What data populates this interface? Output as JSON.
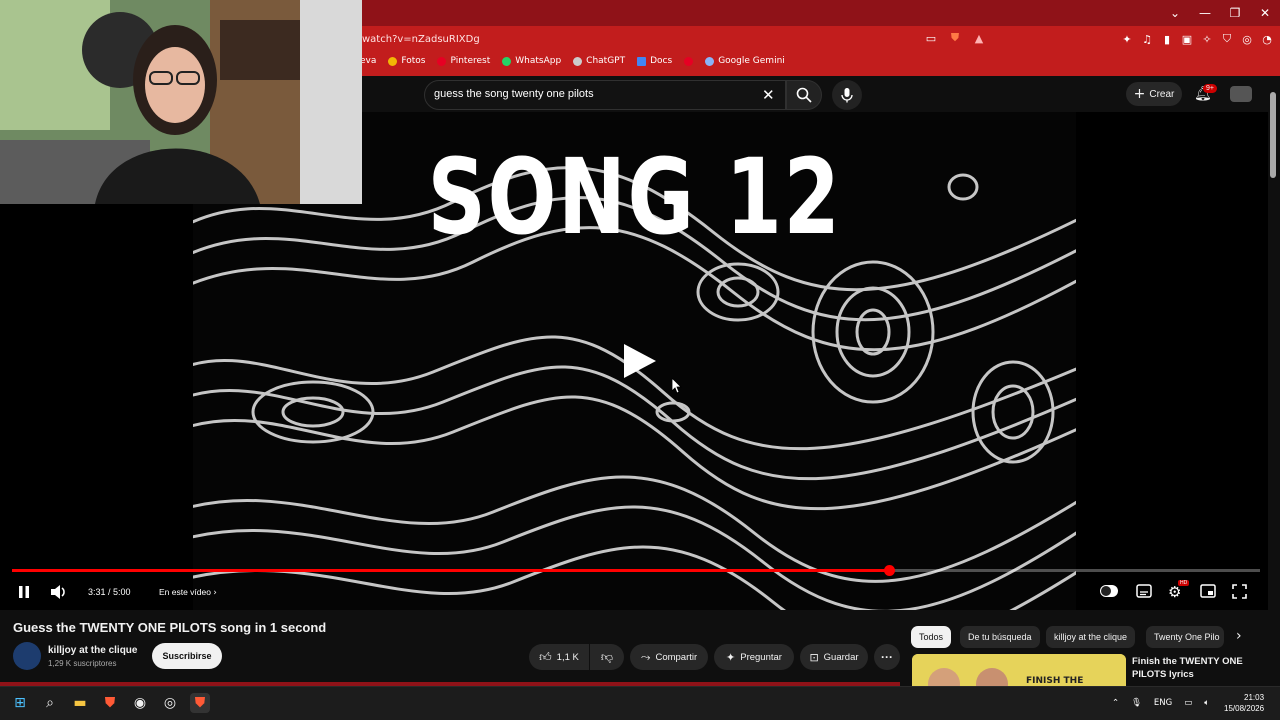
{
  "browser": {
    "url": "watch?v=nZadsuRIXDg",
    "bookmarks": [
      {
        "label": "eva",
        "color": "#888888"
      },
      {
        "label": "Fotos",
        "color": "#f2b705"
      },
      {
        "label": "Pinterest",
        "color": "#e60023"
      },
      {
        "label": "WhatsApp",
        "color": "#25d366"
      },
      {
        "label": "ChatGPT",
        "color": "#cccccc"
      },
      {
        "label": "Docs",
        "color": "#4285f4"
      },
      {
        "label": "",
        "color": "#e60023"
      },
      {
        "label": "Google Gemini",
        "color": "#8ab4f8"
      }
    ],
    "window_controls": [
      "⌄",
      "—",
      "❐",
      "✕"
    ]
  },
  "header": {
    "search_query": "guess the song twenty one pilots",
    "create_label": "Crear",
    "notifications_badge": "9+"
  },
  "player": {
    "overlay_title": "SONG 12",
    "current_time": "3:31",
    "duration": "5:00",
    "time_display": "3:31 / 5:00",
    "chapter_label": "En este vídeo",
    "progress_percent": 70.3
  },
  "video": {
    "title": "Guess the TWENTY ONE PILOTS song in 1 second",
    "channel_name": "killjoy at the clique",
    "subscribers": "1,29 K suscriptores",
    "subscribe_label": "Suscribirse",
    "likes": "1,1 K",
    "share_label": "Compartir",
    "ask_label": "Preguntar",
    "save_label": "Guardar"
  },
  "sidebar": {
    "chips": [
      "Todos",
      "De tu búsqueda",
      "killjoy at the clique",
      "Twenty One Pilo"
    ],
    "recommendation_title": "Finish the TWENTY ONE PILOTS lyrics",
    "thumbnail_text": "FINISH THE"
  },
  "taskbar": {
    "language": "ENG",
    "time": "21:03",
    "date": "15/08/2026"
  },
  "colors": {
    "browser_red": "#c21d1d",
    "title_red": "#8f1218",
    "progress_red": "#ff0000",
    "background": "#0f0f0f"
  }
}
